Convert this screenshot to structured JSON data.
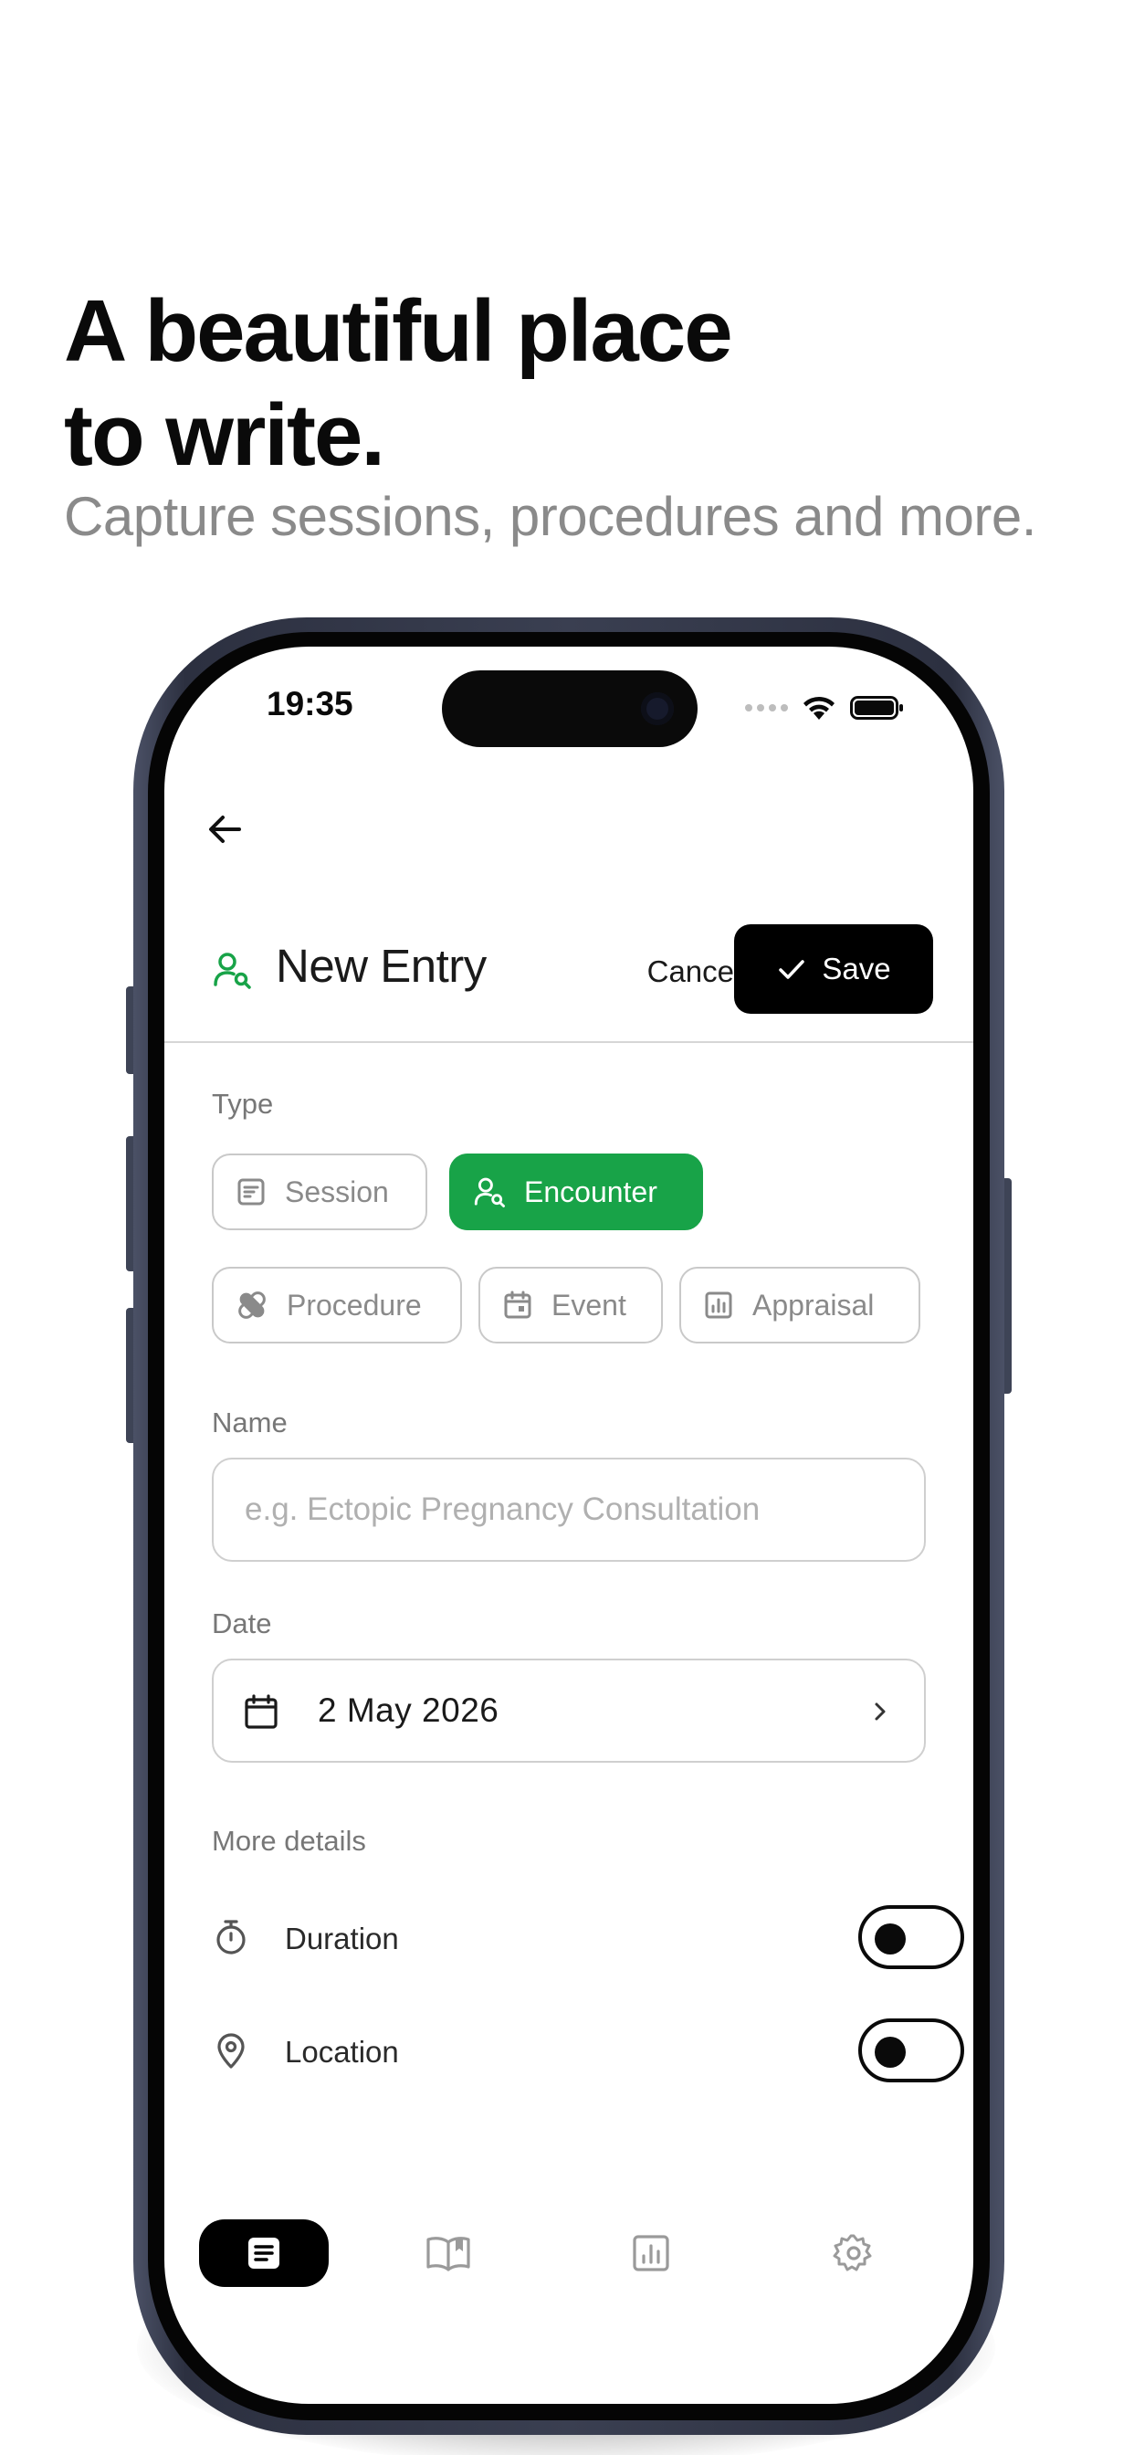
{
  "marketing": {
    "headline_line1": "A beautiful place",
    "headline_line2": "to write.",
    "subheadline": "Capture sessions, procedures and more."
  },
  "status_bar": {
    "time": "19:35"
  },
  "header": {
    "title": "New Entry",
    "cancel_label": "Cancel",
    "save_label": "Save",
    "title_icon": "user-search-icon"
  },
  "type_section": {
    "label": "Type",
    "options": [
      {
        "label": "Session",
        "icon": "notes-icon",
        "selected": false
      },
      {
        "label": "Encounter",
        "icon": "user-search-icon",
        "selected": true
      },
      {
        "label": "Procedure",
        "icon": "bandage-icon",
        "selected": false
      },
      {
        "label": "Event",
        "icon": "calendar-icon",
        "selected": false
      },
      {
        "label": "Appraisal",
        "icon": "chart-icon",
        "selected": false
      }
    ]
  },
  "name_section": {
    "label": "Name",
    "value": "",
    "placeholder": "e.g. Ectopic Pregnancy Consultation"
  },
  "date_section": {
    "label": "Date",
    "value": "2 May 2026"
  },
  "more_details": {
    "label": "More details",
    "rows": [
      {
        "label": "Duration",
        "icon": "stopwatch-icon",
        "enabled": false
      },
      {
        "label": "Location",
        "icon": "map-pin-icon",
        "enabled": false
      }
    ]
  },
  "tab_bar": {
    "tabs": [
      {
        "icon": "entries-icon",
        "active": true
      },
      {
        "icon": "book-icon",
        "active": false
      },
      {
        "icon": "stats-icon",
        "active": false
      },
      {
        "icon": "settings-icon",
        "active": false
      }
    ]
  },
  "colors": {
    "accent_green": "#18a348",
    "primary_black": "#000000",
    "muted_text": "#8a8a8a"
  }
}
